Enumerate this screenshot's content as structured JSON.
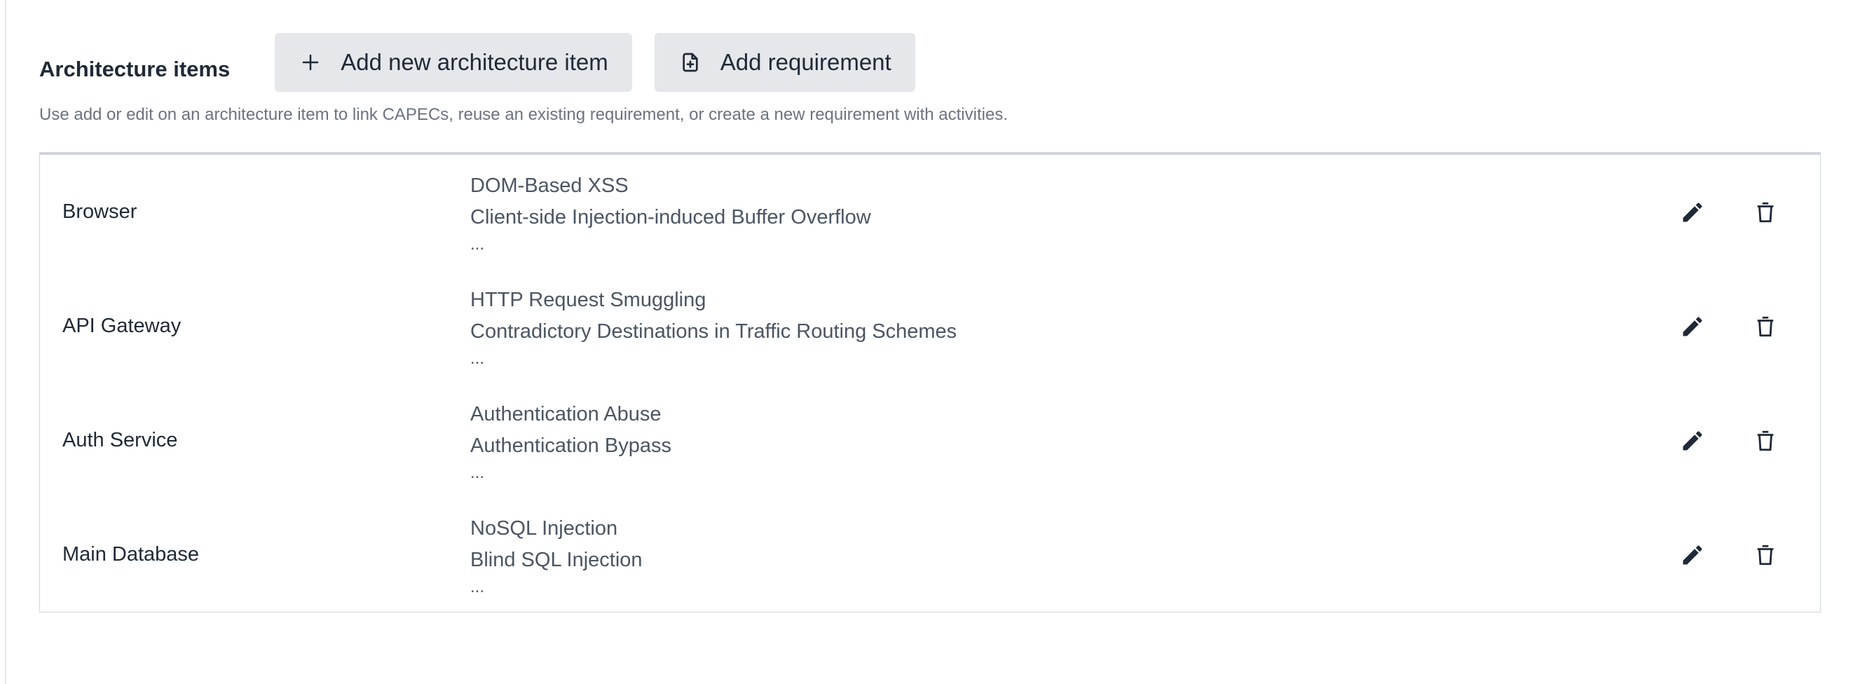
{
  "section": {
    "title": "Architecture items",
    "hint": "Use add or edit on an architecture item to link CAPECs, reuse an existing requirement, or create a new requirement with activities."
  },
  "toolbar": {
    "add_item_label": "Add new architecture item",
    "add_requirement_label": "Add requirement"
  },
  "icons": {
    "add_item": "plus-icon",
    "add_requirement": "file-plus-icon",
    "edit": "pencil-icon",
    "delete": "trash-icon"
  },
  "colors": {
    "text": "#1f2937",
    "muted": "#4b5563",
    "button_bg": "#e5e7eb",
    "border": "#d1d5db"
  },
  "items": [
    {
      "name": "Browser",
      "capecs": [
        "DOM-Based XSS",
        "Client-side Injection-induced Buffer Overflow"
      ],
      "more": "..."
    },
    {
      "name": "API Gateway",
      "capecs": [
        "HTTP Request Smuggling",
        "Contradictory Destinations in Traffic Routing Schemes"
      ],
      "more": "..."
    },
    {
      "name": "Auth Service",
      "capecs": [
        "Authentication Abuse",
        "Authentication Bypass"
      ],
      "more": "..."
    },
    {
      "name": "Main Database",
      "capecs": [
        "NoSQL Injection",
        "Blind SQL Injection"
      ],
      "more": "..."
    }
  ]
}
